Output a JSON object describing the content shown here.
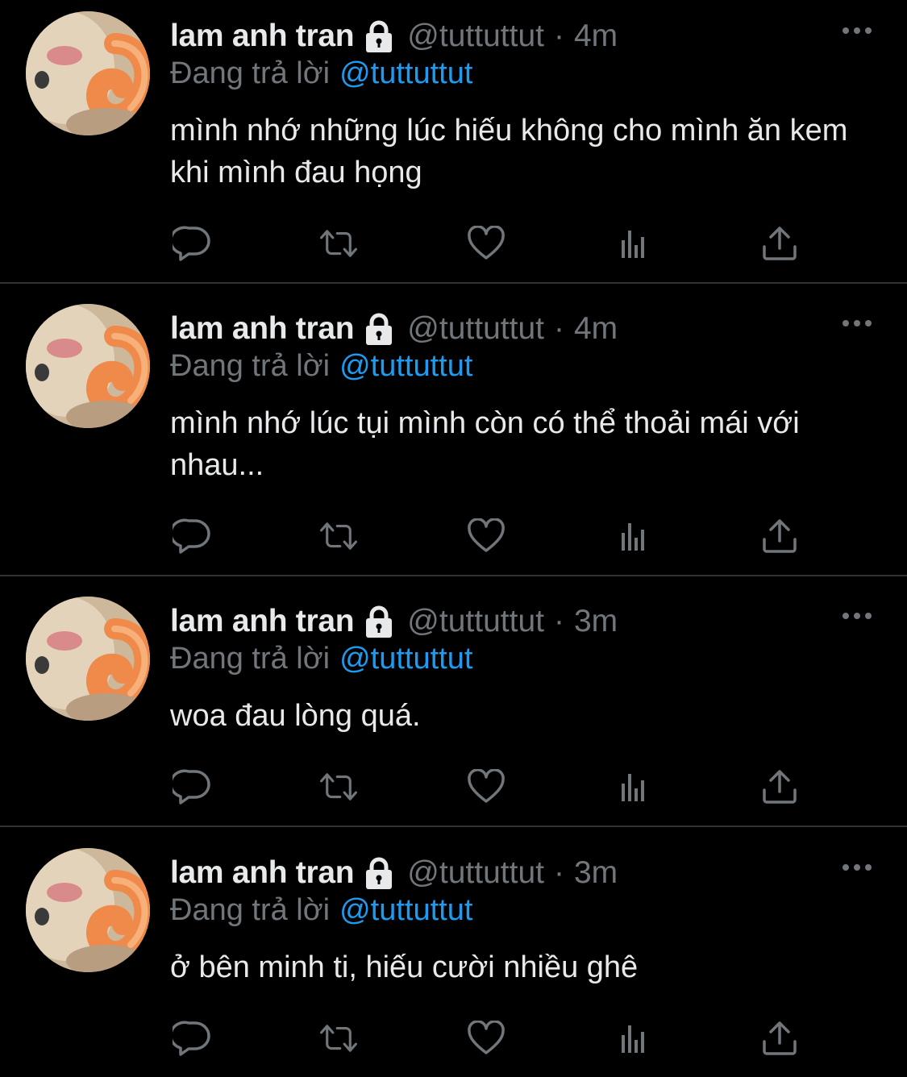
{
  "colors": {
    "background": "#000000",
    "primary_text": "#e7e9ea",
    "secondary_text": "#71767b",
    "link": "#1d9bf0",
    "divider": "#2f3336"
  },
  "tweets": [
    {
      "display_name": "lam anh tran",
      "handle": "@tuttuttut",
      "separator": "·",
      "time": "4m",
      "reply_prefix": "Đang trả lời",
      "reply_to": "@tuttuttut",
      "text": "mình nhớ những lúc hiếu không cho mình ăn kem khi mình đau họng"
    },
    {
      "display_name": "lam anh tran",
      "handle": "@tuttuttut",
      "separator": "·",
      "time": "4m",
      "reply_prefix": "Đang trả lời",
      "reply_to": "@tuttuttut",
      "text": "mình nhớ lúc tụi mình còn có thể thoải mái với nhau..."
    },
    {
      "display_name": "lam anh tran",
      "handle": "@tuttuttut",
      "separator": "·",
      "time": "3m",
      "reply_prefix": "Đang trả lời",
      "reply_to": "@tuttuttut",
      "text": "woa đau lòng quá."
    },
    {
      "display_name": "lam anh tran",
      "handle": "@tuttuttut",
      "separator": "·",
      "time": "3m",
      "reply_prefix": "Đang trả lời",
      "reply_to": "@tuttuttut",
      "text": "ở bên minh ti, hiếu cười nhiều ghê"
    }
  ],
  "icons": {
    "protected": "lock-icon",
    "more": "more-icon",
    "reply": "reply-icon",
    "retweet": "retweet-icon",
    "like": "like-icon",
    "views": "views-icon",
    "share": "share-icon"
  }
}
